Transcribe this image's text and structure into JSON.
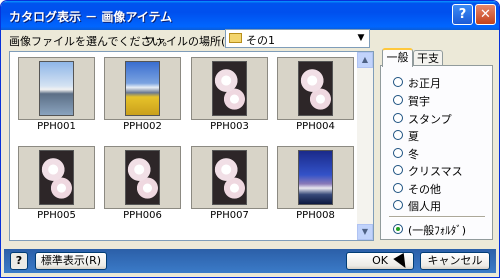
{
  "window": {
    "title": "カタログ表示 － 画像アイテム",
    "help_label": "?",
    "close_label": "✕"
  },
  "toolbar": {
    "prompt": "画像ファイルを選んでください。",
    "location_label": "ファイルの場所(I):",
    "location_value": "その1"
  },
  "thumbnails": [
    {
      "label": "PPH001",
      "image": "lake-mountain"
    },
    {
      "label": "PPH002",
      "image": "mountain-field"
    },
    {
      "label": "PPH003",
      "image": "cherry-blossom"
    },
    {
      "label": "PPH004",
      "image": "cherry-blossom"
    },
    {
      "label": "PPH005",
      "image": "cherry-blossom"
    },
    {
      "label": "PPH006",
      "image": "cherry-blossom"
    },
    {
      "label": "PPH007",
      "image": "cherry-blossom"
    },
    {
      "label": "PPH008",
      "image": "mountain-dusk"
    }
  ],
  "tabs": [
    {
      "label": "一般",
      "active": true
    },
    {
      "label": "干支",
      "active": false
    }
  ],
  "categories": [
    "お正月",
    "賀宇",
    "スタンプ",
    "夏",
    "冬",
    "クリスマス",
    "その他",
    "個人用"
  ],
  "general_folder": "(一般ﾌｫﾙﾀﾞ)",
  "buttons": {
    "help": "?",
    "standard": "標準表示(R)",
    "ok": "OK",
    "cancel": "キャンセル"
  }
}
